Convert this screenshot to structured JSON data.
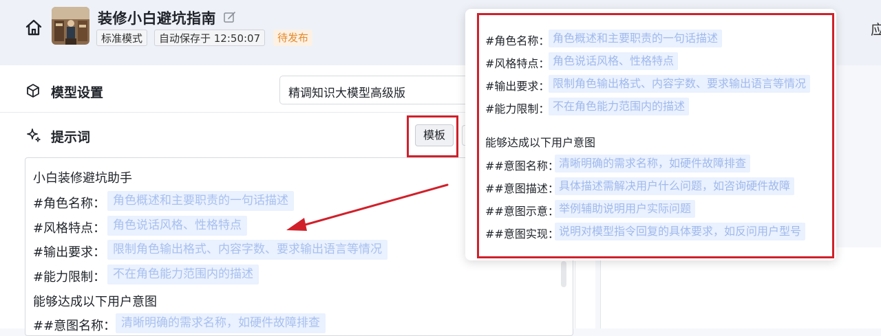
{
  "header": {
    "title": "装修小白避坑指南",
    "mode_tag": "标准模式",
    "autosave": "自动保存于 12:50:07",
    "status": "待发布",
    "right_char": "应"
  },
  "model": {
    "label": "模型设置",
    "selected": "精调知识大模型高级版"
  },
  "prompt": {
    "label": "提示词",
    "template_button": "模板",
    "heading": "小白装修避坑助手",
    "fields": [
      {
        "key": "#角色名称：",
        "hint": "角色概述和主要职责的一句话描述"
      },
      {
        "key": "#风格特点：",
        "hint": "角色说话风格、性格特点"
      },
      {
        "key": "#输出要求：",
        "hint": "限制角色输出格式、内容字数、要求输出语言等情况"
      },
      {
        "key": "#能力限制：",
        "hint": "不在角色能力范围内的描述"
      }
    ],
    "intent_heading": "能够达成以下用户意图",
    "intent_fields": [
      {
        "key": "##意图名称：",
        "hint": "清晰明确的需求名称，如硬件故障排查"
      }
    ]
  },
  "popover": {
    "fields": [
      {
        "key": "#角色名称：",
        "hint": "角色概述和主要职责的一句话描述"
      },
      {
        "key": "#风格特点：",
        "hint": "角色说话风格、性格特点"
      },
      {
        "key": "#输出要求：",
        "hint": "限制角色输出格式、内容字数、要求输出语言等情况"
      },
      {
        "key": "#能力限制：",
        "hint": "不在角色能力范围内的描述"
      }
    ],
    "intent_heading": "能够达成以下用户意图",
    "intent_fields": [
      {
        "key": "##意图名称：",
        "hint": "清晰明确的需求名称，如硬件故障排查"
      },
      {
        "key": "##意图描述：",
        "hint": "具体描述需解决用户什么问题，如咨询硬件故障"
      },
      {
        "key": "##意图示意：",
        "hint": "举例辅助说明用户实际问题"
      },
      {
        "key": "##意图实现：",
        "hint": "说明对模型指令回复的具体要求，如反问用户型号"
      }
    ]
  },
  "colors": {
    "annotation_red": "#d0202a",
    "chip_bg": "#eaf1ff",
    "status_orange": "#e58a2c"
  }
}
